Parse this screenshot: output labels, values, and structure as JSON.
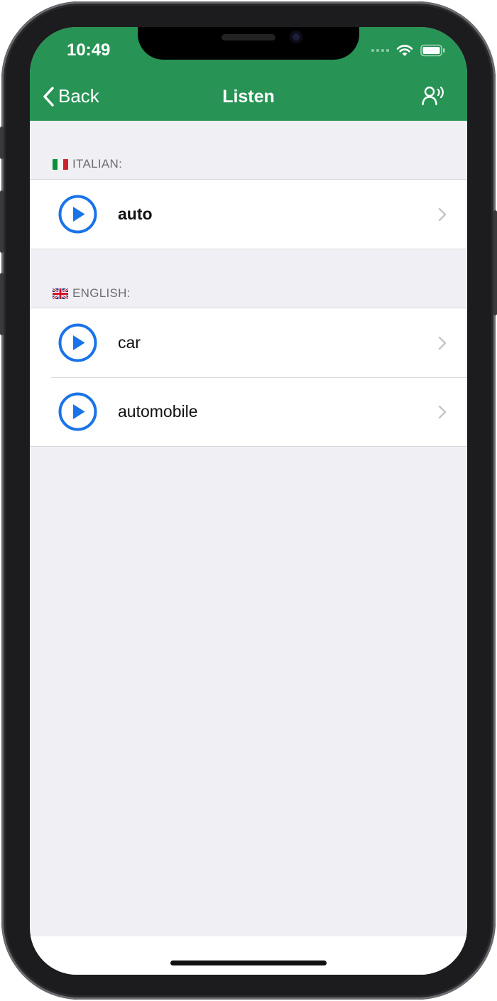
{
  "status_bar": {
    "time": "10:49",
    "icons": [
      "cellular-icon",
      "wifi-icon",
      "battery-icon"
    ]
  },
  "nav": {
    "back_label": "Back",
    "title": "Listen",
    "right_icon": "speaking-person-icon"
  },
  "colors": {
    "header_green": "#279355",
    "play_blue": "#1a73e8",
    "background": "#efeff4"
  },
  "sections": [
    {
      "header": "ITALIAN:",
      "flag": "italy-flag-icon",
      "items": [
        {
          "label": "auto",
          "bold": true,
          "icon": "play-icon"
        }
      ]
    },
    {
      "header": "ENGLISH:",
      "flag": "uk-flag-icon",
      "items": [
        {
          "label": "car",
          "bold": false,
          "icon": "play-icon"
        },
        {
          "label": "automobile",
          "bold": false,
          "icon": "play-icon"
        }
      ]
    }
  ]
}
